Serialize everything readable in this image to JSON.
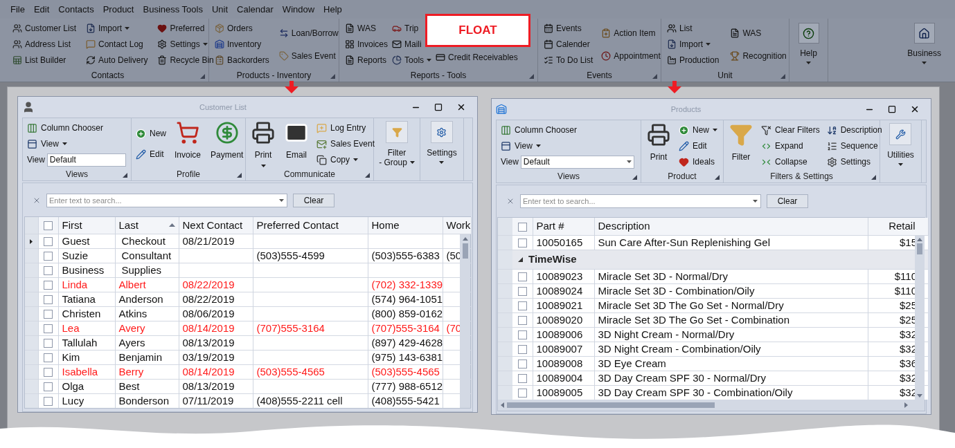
{
  "menu_bar": [
    {
      "label": "File"
    },
    {
      "label": "Edit"
    },
    {
      "label": "Contacts"
    },
    {
      "label": "Product"
    },
    {
      "label": "Business Tools"
    },
    {
      "label": "Unit"
    },
    {
      "label": "Calendar"
    },
    {
      "label": "Window"
    },
    {
      "label": "Help"
    }
  ],
  "ribbon": {
    "groups": [
      {
        "title": "Contacts",
        "columns": [
          [
            {
              "label": "Customer List",
              "dropdown": false
            },
            {
              "label": "Address List",
              "dropdown": false
            },
            {
              "label": "List Builder",
              "dropdown": false
            }
          ],
          [
            {
              "label": "Import",
              "dropdown": true
            },
            {
              "label": "Contact Log",
              "dropdown": false
            },
            {
              "label": "Auto Delivery",
              "dropdown": false
            }
          ],
          [
            {
              "label": "Preferred",
              "dropdown": false
            },
            {
              "label": "Settings",
              "dropdown": true
            },
            {
              "label": "Recycle Bin",
              "dropdown": false
            }
          ]
        ]
      },
      {
        "title": "Products - Inventory",
        "columns": [
          [
            {
              "label": "Orders",
              "dropdown": false
            },
            {
              "label": "Inventory",
              "dropdown": false
            },
            {
              "label": "Backorders",
              "dropdown": false
            }
          ],
          [
            {
              "label": "Loan/Borrow",
              "dropdown": false
            },
            {
              "label": "Sales Event",
              "dropdown": false
            }
          ]
        ]
      },
      {
        "title": "Reports - Tools",
        "columns": [
          [
            {
              "label": "WAS",
              "dropdown": false
            },
            {
              "label": "Invoices",
              "dropdown": false
            },
            {
              "label": "Reports",
              "dropdown": false
            }
          ],
          [
            {
              "label": "Trip",
              "dropdown": false
            },
            {
              "label": "Maili",
              "dropdown": false
            },
            {
              "label": "Tools",
              "dropdown": true
            }
          ],
          [
            {
              "label": "Credit Receivables",
              "dropdown": false
            }
          ]
        ]
      },
      {
        "title": "Events",
        "columns": [
          [
            {
              "label": "Events",
              "dropdown": false
            },
            {
              "label": "Calender",
              "dropdown": false
            },
            {
              "label": "To Do List",
              "dropdown": false
            }
          ],
          [
            {
              "label": "Action Item",
              "dropdown": false
            },
            {
              "label": "Appointment",
              "dropdown": false
            }
          ]
        ]
      },
      {
        "title": "Unit",
        "columns": [
          [
            {
              "label": "List",
              "dropdown": false
            },
            {
              "label": "Import",
              "dropdown": true
            },
            {
              "label": "Production",
              "dropdown": false
            }
          ],
          [
            {
              "label": "WAS",
              "dropdown": false
            },
            {
              "label": "Recognition",
              "dropdown": false
            }
          ]
        ]
      },
      {
        "large": {
          "label": "Help",
          "dropdown": true
        }
      },
      {
        "large": {
          "label": "Business",
          "dropdown": true
        }
      }
    ]
  },
  "callout": {
    "text": "FLOAT"
  },
  "customer_list": {
    "title": "Customer List",
    "ribbon": [
      {
        "title": "Views",
        "columns": [
          [
            {
              "kind": "small",
              "label": "Column Chooser",
              "dropdown": false
            },
            {
              "kind": "small",
              "label": "View",
              "dropdown": true
            },
            {
              "kind": "field",
              "label": "View",
              "value": "Default",
              "dropdown": false
            }
          ]
        ]
      },
      {
        "title": "Profile",
        "columns": [
          [
            {
              "kind": "small",
              "label": "New",
              "dropdown": false
            },
            {
              "kind": "small",
              "label": "Edit",
              "dropdown": false
            }
          ],
          [
            {
              "kind": "large",
              "label": "Invoice",
              "dropdown": false
            }
          ],
          [
            {
              "kind": "large",
              "label": "Payment",
              "dropdown": false
            }
          ]
        ]
      },
      {
        "title": "Communicate",
        "columns": [
          [
            {
              "kind": "large",
              "label": "Print",
              "dropdown": true
            }
          ],
          [
            {
              "kind": "large",
              "label": "Email",
              "dropdown": false
            }
          ],
          [
            {
              "kind": "small",
              "label": "Log Entry",
              "dropdown": false
            },
            {
              "kind": "small",
              "label": "Sales Event",
              "dropdown": false
            },
            {
              "kind": "small",
              "label": "Copy",
              "dropdown": true
            }
          ]
        ]
      },
      {
        "columns": [
          [
            {
              "kind": "boxed",
              "label": "Filter",
              "sublabel": "- Group",
              "dropdown": true
            }
          ]
        ]
      },
      {
        "columns": [
          [
            {
              "kind": "boxed",
              "label": "Settings",
              "dropdown": true
            }
          ]
        ]
      }
    ],
    "search": {
      "placeholder": "Enter text to search...",
      "clear": "Clear"
    },
    "select_all": {
      "checked": false
    },
    "columns": [
      {
        "label": "First",
        "sorted": false
      },
      {
        "label": "Last",
        "sorted": true
      },
      {
        "label": "Next Contact",
        "sorted": false
      },
      {
        "label": "Preferred Contact",
        "sorted": false
      },
      {
        "label": "Home",
        "sorted": false
      },
      {
        "label": "Work",
        "sorted": false
      }
    ],
    "rows": [
      {
        "current": true,
        "checked": false,
        "highlighted": false,
        "first": "Guest",
        "last": "Checkout",
        "next_contact": "08/21/2019"
      },
      {
        "current": false,
        "checked": false,
        "highlighted": false,
        "first": "Suzie",
        "last": "Consultant",
        "preferred_contact": "(503)555-4599",
        "home": "(503)555-6383",
        "work": "(50"
      },
      {
        "current": false,
        "checked": false,
        "highlighted": false,
        "first": "Business",
        "last": "Supplies"
      },
      {
        "current": false,
        "checked": false,
        "highlighted": true,
        "first": "Linda",
        "last": "Albert",
        "next_contact": "08/22/2019",
        "home": "(702) 332-1339"
      },
      {
        "current": false,
        "checked": false,
        "highlighted": false,
        "first": "Tatiana",
        "last": "Anderson",
        "next_contact": "08/22/2019",
        "home": "(574) 964-1051"
      },
      {
        "current": false,
        "checked": false,
        "highlighted": false,
        "first": "Christen",
        "last": "Atkins",
        "next_contact": "08/06/2019",
        "home": "(800) 859-0162"
      },
      {
        "current": false,
        "checked": false,
        "highlighted": true,
        "first": "Lea",
        "last": "Avery",
        "next_contact": "08/14/2019",
        "preferred_contact": "(707)555-3164",
        "home": "(707)555-3164",
        "work": "(70"
      },
      {
        "current": false,
        "checked": false,
        "highlighted": false,
        "first": "Tallulah",
        "last": "Ayers",
        "next_contact": "08/13/2019",
        "home": "(897) 429-4628"
      },
      {
        "current": false,
        "checked": false,
        "highlighted": false,
        "first": "Kim",
        "last": "Benjamin",
        "next_contact": "03/19/2019",
        "home": "(975) 143-6381"
      },
      {
        "current": false,
        "checked": false,
        "highlighted": true,
        "first": "Isabella",
        "last": "Berry",
        "next_contact": "08/14/2019",
        "preferred_contact": "(503)555-4565",
        "home": "(503)555-4565"
      },
      {
        "current": false,
        "checked": false,
        "highlighted": false,
        "first": "Olga",
        "last": "Best",
        "next_contact": "08/13/2019",
        "home": "(777) 988-6512"
      },
      {
        "current": false,
        "checked": false,
        "highlighted": false,
        "first": "Lucy",
        "last": "Bonderson",
        "next_contact": "07/11/2019",
        "preferred_contact": "(408)555-2211 cell",
        "home": "(408)555-5421"
      }
    ]
  },
  "products": {
    "title": "Products",
    "ribbon": [
      {
        "title": "Views",
        "columns": [
          [
            {
              "kind": "small",
              "label": "Column Chooser",
              "dropdown": false
            },
            {
              "kind": "small",
              "label": "View",
              "dropdown": true
            },
            {
              "kind": "field",
              "label": "View",
              "value": "Default",
              "dropdown": true
            }
          ]
        ]
      },
      {
        "title": "Product",
        "columns": [
          [
            {
              "kind": "large",
              "label": "Print",
              "dropdown": false
            }
          ],
          [
            {
              "kind": "small",
              "label": "New",
              "dropdown": true
            },
            {
              "kind": "small",
              "label": "Edit",
              "dropdown": false
            },
            {
              "kind": "small",
              "label": "Ideals",
              "dropdown": false
            }
          ]
        ]
      },
      {
        "title": "Filters & Settings",
        "columns": [
          [
            {
              "kind": "large",
              "label": "Filter",
              "dropdown": false
            }
          ],
          [
            {
              "kind": "small",
              "label": "Clear Filters",
              "dropdown": false
            },
            {
              "kind": "small",
              "label": "Expand",
              "dropdown": false
            },
            {
              "kind": "small",
              "label": "Collapse",
              "dropdown": false
            }
          ],
          [
            {
              "kind": "small",
              "label": "Description",
              "dropdown": false
            },
            {
              "kind": "small",
              "label": "Sequence",
              "dropdown": false
            },
            {
              "kind": "small",
              "label": "Settings",
              "dropdown": false
            }
          ]
        ]
      },
      {
        "columns": [
          [
            {
              "kind": "boxed",
              "label": "Utilities",
              "dropdown": true
            }
          ]
        ]
      }
    ],
    "search": {
      "placeholder": "Enter text to search...",
      "clear": "Clear"
    },
    "select_all": {
      "checked": false
    },
    "columns": [
      {
        "label": "Part #"
      },
      {
        "label": "Description"
      },
      {
        "label": "Retail"
      }
    ],
    "rows": [
      {
        "kind": "item",
        "checked": false,
        "part": "10050165",
        "description": "Sun Care After-Sun Replenishing Gel",
        "retail": "$15"
      },
      {
        "kind": "group",
        "label": "TimeWise",
        "expanded": true
      },
      {
        "kind": "item",
        "checked": false,
        "part": "10089023",
        "description": "Miracle Set 3D - Normal/Dry",
        "retail": "$110"
      },
      {
        "kind": "item",
        "checked": false,
        "part": "10089024",
        "description": "Miracle Set 3D - Combination/Oily",
        "retail": "$110"
      },
      {
        "kind": "item",
        "checked": false,
        "part": "10089021",
        "description": "Miracle Set 3D The Go Set - Normal/Dry",
        "retail": "$25"
      },
      {
        "kind": "item",
        "checked": false,
        "part": "10089020",
        "description": "Miracle Set 3D The Go Set - Combination",
        "retail": "$25"
      },
      {
        "kind": "item",
        "checked": false,
        "part": "10089006",
        "description": "3D Night Cream - Normal/Dry",
        "retail": "$32"
      },
      {
        "kind": "item",
        "checked": false,
        "part": "10089007",
        "description": "3D Night Cream - Combination/Oily",
        "retail": "$32"
      },
      {
        "kind": "item",
        "checked": false,
        "part": "10089008",
        "description": "3D Eye Cream",
        "retail": "$36"
      },
      {
        "kind": "item",
        "checked": false,
        "part": "10089004",
        "description": "3D Day Cream SPF 30 - Normal/Dry",
        "retail": "$32"
      },
      {
        "kind": "item",
        "checked": false,
        "part": "10089005",
        "description": "3D Day Cream SPF 30 - Combination/Oily",
        "retail": "$32"
      }
    ]
  }
}
